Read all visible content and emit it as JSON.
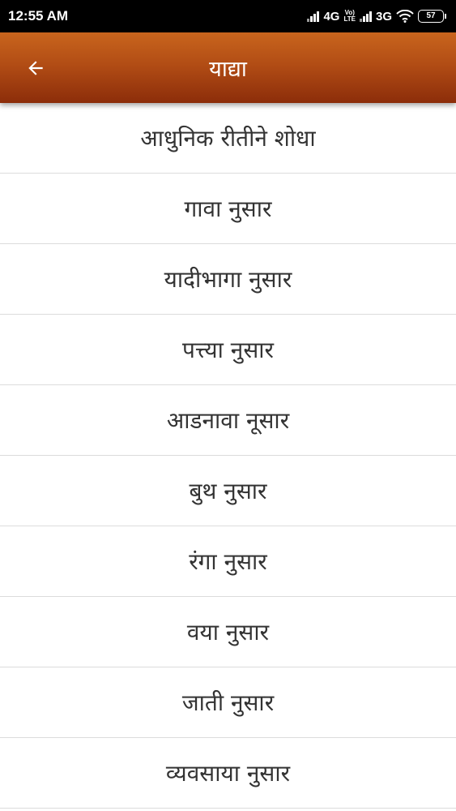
{
  "status_bar": {
    "time": "12:55 AM",
    "network_1": "4G",
    "network_1_suffix": "+",
    "volte_top": "Vo)",
    "volte_bottom": "LTE",
    "network_2": "3G",
    "battery": "57"
  },
  "app_bar": {
    "title": "याद्या",
    "back_icon": "back-arrow-icon",
    "background_top": "#c9651d",
    "background_bottom": "#8c2d0a"
  },
  "menu": {
    "items": [
      {
        "label": "आधुनिक रीतीने शोधा"
      },
      {
        "label": "गावा नुसार"
      },
      {
        "label": "यादीभागा नुसार"
      },
      {
        "label": "पत्त्या नुसार"
      },
      {
        "label": "आडनावा नूसार"
      },
      {
        "label": "बुथ नुसार"
      },
      {
        "label": "रंगा नुसार"
      },
      {
        "label": "वया नुसार"
      },
      {
        "label": "जाती नुसार"
      },
      {
        "label": "व्यवसाया नुसार"
      }
    ]
  }
}
